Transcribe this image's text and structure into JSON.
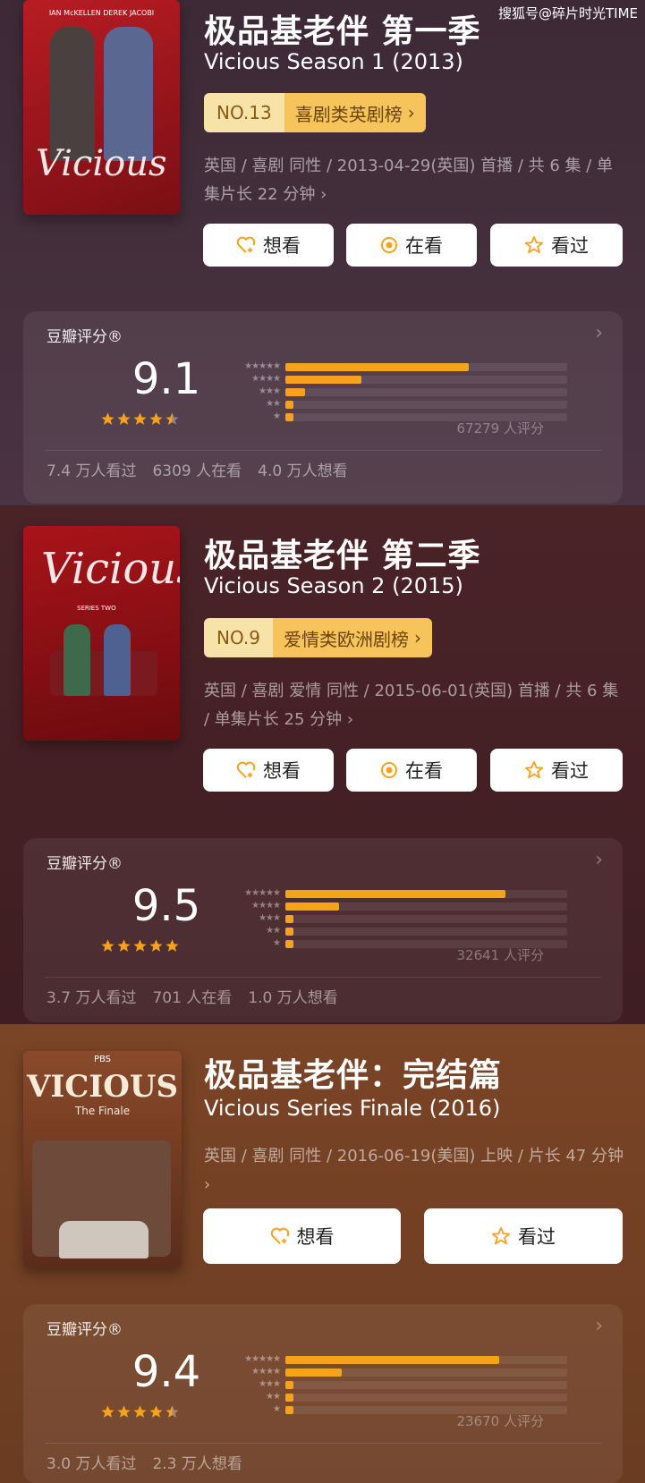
{
  "watermark": "搜狐号@碎片时光TIME",
  "shows": [
    {
      "title": "极品基老伴 第一季",
      "subtitle": "Vicious Season 1 (2013)",
      "rank_no": "NO.13",
      "rank_cat": "喜剧类英剧榜",
      "info": "英国 / 喜剧 同性 / 2013-04-29(英国) 首播 / 共 6 集 / 单集片长 22 分钟",
      "poster_top_text": "IAN McKELLEN      DEREK JACOBI",
      "poster_logo": "Vicious",
      "btn_want": "想看",
      "btn_watching": "在看",
      "btn_watched": "看过",
      "rating_label": "豆瓣评分®",
      "score": "9.1",
      "star_rating": 4.5,
      "distribution": [
        0.65,
        0.27,
        0.07,
        0.03,
        0.03
      ],
      "raters": "67279 人评分",
      "counts": [
        "7.4 万人看过",
        "6309 人在看",
        "4.0 万人想看"
      ]
    },
    {
      "title": "极品基老伴 第二季",
      "subtitle": "Vicious Season 2 (2015)",
      "rank_no": "NO.9",
      "rank_cat": "爱情类欧洲剧榜",
      "info": "英国 / 喜剧 爱情 同性 / 2015-06-01(英国) 首播 / 共 6 集 / 单集片长 25 分钟",
      "poster_top_text": "SERIES TWO",
      "poster_logo": "Vicious",
      "btn_want": "想看",
      "btn_watching": "在看",
      "btn_watched": "看过",
      "rating_label": "豆瓣评分®",
      "score": "9.5",
      "star_rating": 5,
      "distribution": [
        0.78,
        0.19,
        0.03,
        0.02,
        0.02
      ],
      "raters": "32641 人评分",
      "counts": [
        "3.7 万人看过",
        "701 人在看",
        "1.0 万人想看"
      ]
    },
    {
      "title": "极品基老伴：完结篇",
      "subtitle": "Vicious Series Finale (2016)",
      "info": "英国 / 喜剧 同性 / 2016-06-19(美国) 上映 / 片长 47 分钟",
      "poster_top_text": "PBS",
      "poster_logo": "VICIOUS",
      "poster_sub": "The Finale",
      "btn_want": "想看",
      "btn_watched": "看过",
      "rating_label": "豆瓣评分®",
      "score": "9.4",
      "star_rating": 4.5,
      "distribution": [
        0.76,
        0.2,
        0.03,
        0.02,
        0.02
      ],
      "raters": "23670 人评分",
      "counts": [
        "3.0 万人看过",
        "2.3 万人想看"
      ]
    }
  ],
  "colors": {
    "accent": "#f7a21b",
    "rank_light": "#f7e3a8",
    "rank_dark": "#f6c45b"
  }
}
